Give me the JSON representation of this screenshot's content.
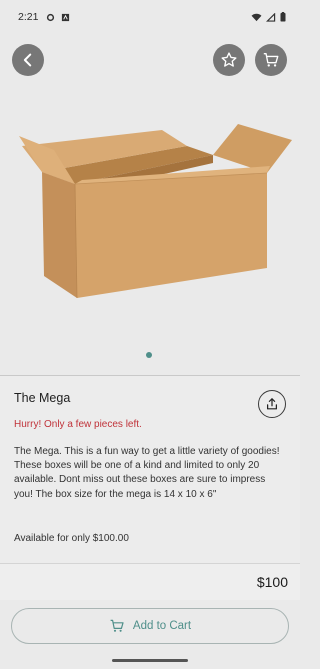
{
  "status_bar": {
    "time": "2:21"
  },
  "product": {
    "title": "The Mega",
    "stock_warning": "Hurry! Only a few pieces left.",
    "description": "The Mega. This is a fun way to get a little variety of goodies! These boxes will be one of a kind and limited to only 20 available. Dont miss out these boxes are sure to impress you! The box size for the mega is 14 x 10 x 6\"",
    "availability": "Available for only $100.00",
    "price": "$100",
    "image_index": 1,
    "image_count": 1
  },
  "actions": {
    "add_to_cart_label": "Add to Cart"
  },
  "colors": {
    "accent": "#4f8f8a",
    "warning": "#c0333a",
    "icon_button_bg": "#777777"
  },
  "icons": [
    "back-arrow-icon",
    "star-icon",
    "cart-icon",
    "share-icon",
    "add-cart-icon"
  ]
}
